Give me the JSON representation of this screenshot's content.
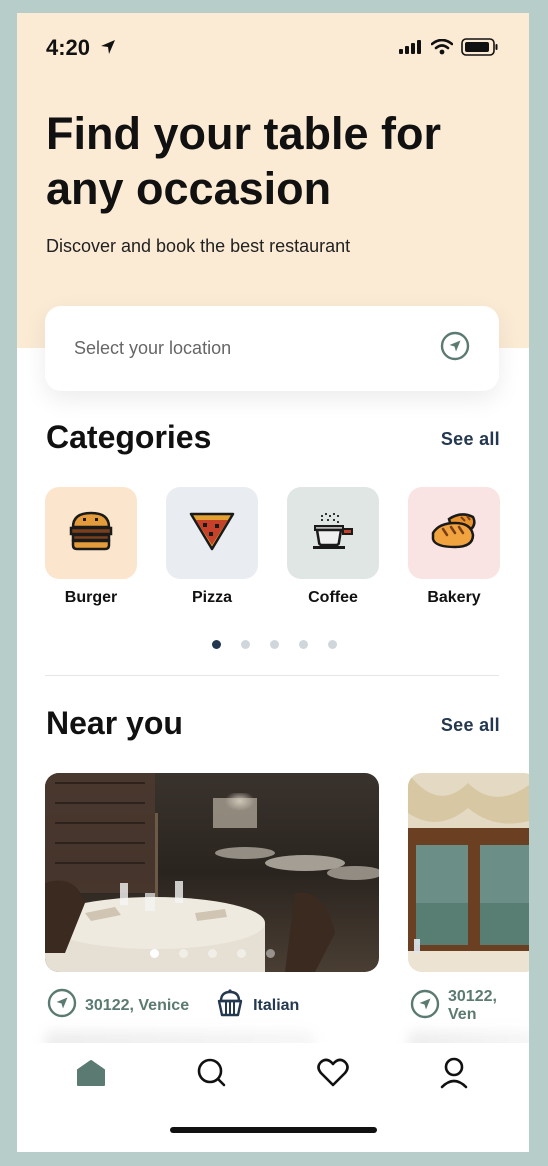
{
  "status_bar": {
    "time": "4:20"
  },
  "hero": {
    "title": "Find your table for any occasion",
    "subtitle": "Discover and book the best restaurant"
  },
  "location": {
    "placeholder": "Select your location"
  },
  "categories": {
    "title": "Categories",
    "see_all": "See all",
    "items": [
      {
        "label": "Burger",
        "icon": "burger-icon",
        "bg": "#fbe6cd"
      },
      {
        "label": "Pizza",
        "icon": "pizza-icon",
        "bg": "#e9edf1"
      },
      {
        "label": "Coffee",
        "icon": "coffee-icon",
        "bg": "#dfe6e3"
      },
      {
        "label": "Bakery",
        "icon": "bakery-icon",
        "bg": "#f9e4e3"
      }
    ],
    "page_count": 5,
    "active_page": 0
  },
  "near_you": {
    "title": "Near you",
    "see_all": "See all",
    "cards": [
      {
        "location": "30122, Venice",
        "cuisine": "Italian",
        "image_dots": 5,
        "active_image": 0
      },
      {
        "location": "30122, Ven"
      }
    ]
  },
  "tab_bar": {
    "items": [
      {
        "name": "home",
        "icon": "home-icon",
        "active": true
      },
      {
        "name": "search",
        "icon": "search-icon",
        "active": false
      },
      {
        "name": "favorites",
        "icon": "heart-icon",
        "active": false
      },
      {
        "name": "profile",
        "icon": "user-icon",
        "active": false
      }
    ]
  },
  "colors": {
    "hero_bg": "#fcebd4",
    "accent": "#5b7a72",
    "navy": "#24384f"
  }
}
